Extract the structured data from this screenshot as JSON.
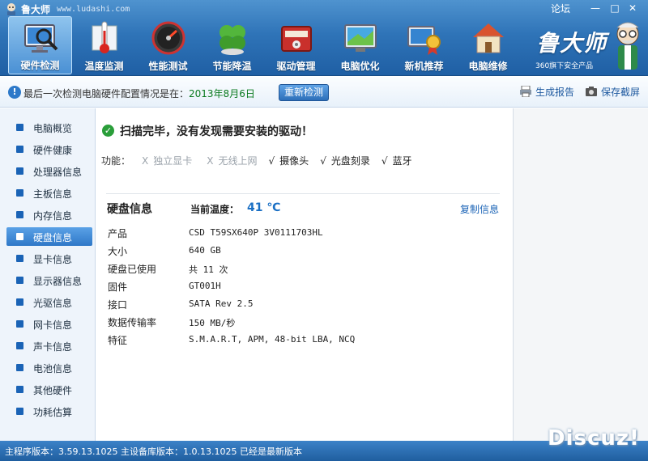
{
  "window": {
    "title": "鲁大师",
    "url": "www.ludashi.com",
    "forum_label": "论坛",
    "min_label": "—",
    "max_label": "□",
    "close_label": "✕"
  },
  "nav": [
    {
      "label": "硬件检测",
      "icon": "monitor-magnifier-icon"
    },
    {
      "label": "温度监测",
      "icon": "thermometer-icon"
    },
    {
      "label": "性能测试",
      "icon": "speedometer-icon"
    },
    {
      "label": "节能降温",
      "icon": "clover-icon"
    },
    {
      "label": "驱动管理",
      "icon": "driver-box-icon"
    },
    {
      "label": "电脑优化",
      "icon": "optimize-screen-icon"
    },
    {
      "label": "新机推荐",
      "icon": "new-pc-medal-icon"
    },
    {
      "label": "电脑维修",
      "icon": "house-repair-icon"
    }
  ],
  "brand": {
    "name": "鲁大师",
    "sub": "360旗下安全产品"
  },
  "infobar": {
    "text": "最后一次检测电脑硬件配置情况是在：",
    "date": "2013年8月6日",
    "redetect": "重新检测",
    "report": "生成报告",
    "screenshot": "保存截屏"
  },
  "sidebar": {
    "active_index": 5,
    "items": [
      {
        "label": "电脑概览"
      },
      {
        "label": "硬件健康"
      },
      {
        "label": "处理器信息"
      },
      {
        "label": "主板信息"
      },
      {
        "label": "内存信息"
      },
      {
        "label": "硬盘信息"
      },
      {
        "label": "显卡信息"
      },
      {
        "label": "显示器信息"
      },
      {
        "label": "光驱信息"
      },
      {
        "label": "网卡信息"
      },
      {
        "label": "声卡信息"
      },
      {
        "label": "电池信息"
      },
      {
        "label": "其他硬件"
      },
      {
        "label": "功耗估算"
      }
    ]
  },
  "scan": {
    "message": "扫描完毕，没有发现需要安装的驱动！",
    "features_label": "功能：",
    "features": [
      {
        "mark": "X",
        "label": "独立显卡",
        "available": false
      },
      {
        "mark": "X",
        "label": "无线上网",
        "available": false
      },
      {
        "mark": "√",
        "label": "摄像头",
        "available": true
      },
      {
        "mark": "√",
        "label": "光盘刻录",
        "available": true
      },
      {
        "mark": "√",
        "label": "蓝牙",
        "available": true
      }
    ]
  },
  "disk": {
    "title": "硬盘信息",
    "temp_label": "当前温度：",
    "temp_value": "41 ℃",
    "copy_label": "复制信息",
    "specs": [
      {
        "key": "产品",
        "value": "CSD T59SX640P 3V0111703HL"
      },
      {
        "key": "大小",
        "value": "640 GB"
      },
      {
        "key": "硬盘已使用",
        "value": "共 11 次"
      },
      {
        "key": "固件",
        "value": "GT001H"
      },
      {
        "key": "接口",
        "value": "SATA Rev 2.5"
      },
      {
        "key": "数据传输率",
        "value": "150 MB/秒"
      },
      {
        "key": "特征",
        "value": "S.M.A.R.T,  APM,  48-bit LBA,  NCQ"
      }
    ]
  },
  "status": {
    "text": "主程序版本：3.59.13.1025  主设备库版本：1.0.13.1025  已经是最新版本"
  },
  "watermark": "Discuz!",
  "colors": {
    "accent": "#2f74b8",
    "ok": "#2a9e3a",
    "temp": "#1a6fc4"
  }
}
